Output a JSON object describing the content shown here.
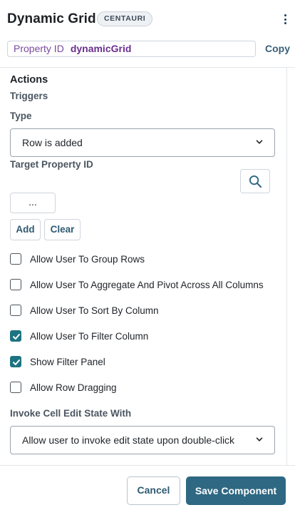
{
  "header": {
    "title": "Dynamic Grid",
    "badge": "CENTAURI",
    "property_id_label": "Property ID",
    "property_id_value": "dynamicGrid",
    "copy_label": "Copy"
  },
  "actions": {
    "heading": "Actions",
    "triggers_label": "Triggers",
    "type_label": "Type",
    "type_selected": "Row is added",
    "target_label": "Target Property ID",
    "target_value": "...",
    "add_label": "Add",
    "clear_label": "Clear"
  },
  "options": [
    {
      "label": "Allow User To Group Rows",
      "checked": false
    },
    {
      "label": "Allow User To Aggregate And Pivot Across All Columns",
      "checked": false
    },
    {
      "label": "Allow User To Sort By Column",
      "checked": false
    },
    {
      "label": "Allow User To Filter Column",
      "checked": true
    },
    {
      "label": "Show Filter Panel",
      "checked": true
    },
    {
      "label": "Allow Row Dragging",
      "checked": false
    }
  ],
  "edit_state": {
    "label": "Invoke Cell Edit State With",
    "selected": "Allow user to invoke edit state upon double-click"
  },
  "footer": {
    "cancel_label": "Cancel",
    "save_label": "Save Component"
  },
  "colors": {
    "accent": "#2e6882",
    "checkbox_checked": "#1d7481",
    "property_text": "#6a2f8f"
  }
}
